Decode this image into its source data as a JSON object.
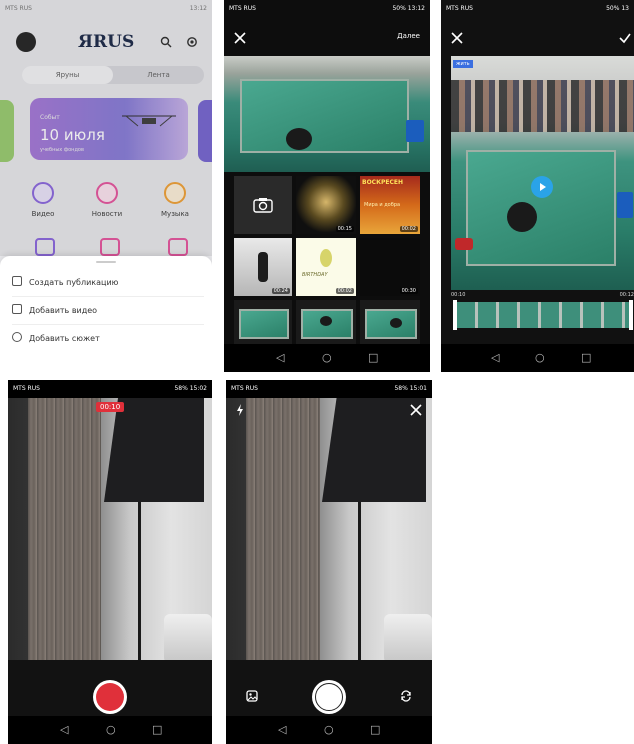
{
  "screen1": {
    "status_left": "MTS RUS",
    "status_right": "13:12",
    "logo": "ЯRUS",
    "tabs": [
      "Яруны",
      "Лента"
    ],
    "banner": {
      "small": "Событ",
      "date": "10 июля",
      "sub": "учебных фондов"
    },
    "categories": [
      {
        "label": "Видео",
        "color": "#8f6cdf"
      },
      {
        "label": "Новости",
        "color": "#e75aa1"
      },
      {
        "label": "Музыка",
        "color": "#f0a33c"
      }
    ],
    "sheet_items": [
      "Создать публикацию",
      "Добавить видео",
      "Добавить сюжет"
    ]
  },
  "screen2": {
    "status_left": "MTS RUS",
    "status_right": "50% 13:12",
    "next_label": "Далее",
    "thumb_durations": [
      "00:15",
      "00:02",
      "00:24",
      "00:02",
      "00:30"
    ],
    "thumb_text": [
      "ВОСКРЕСЕН",
      "Мира и добра",
      "BIRTHDAY"
    ]
  },
  "screen3": {
    "status_left": "MTS RUS",
    "status_right": "50% 13",
    "time_start": "00:10",
    "time_end": "00:12",
    "tag": "жить"
  },
  "screen4": {
    "status_left": "MTS RUS",
    "status_right": "58% 15:02",
    "timer": "00:10"
  },
  "screen5": {
    "status_left": "MTS RUS",
    "status_right": "58% 15:01"
  },
  "colors": {
    "accent_purple": "#8f6cdf",
    "record_red": "#e0303a",
    "play_blue": "#2aa3e8"
  }
}
